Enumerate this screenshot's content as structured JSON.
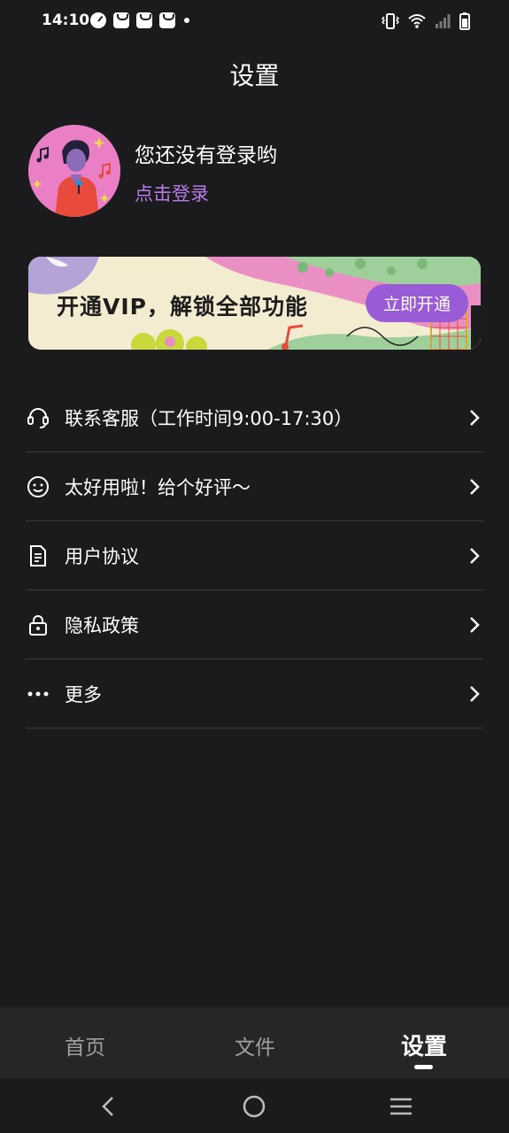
{
  "status_bar": {
    "time": "14:10",
    "left_icons": [
      "gauge-icon",
      "bag-icon",
      "bag-icon",
      "bag-icon",
      "dot-icon"
    ],
    "right_icons": [
      "vibrate-icon",
      "wifi-icon",
      "signal-icon",
      "battery-icon"
    ]
  },
  "header": {
    "title": "设置"
  },
  "profile": {
    "title": "您还没有登录哟",
    "login_link": "点击登录",
    "avatar_colors": {
      "bg": "#ea7fc6"
    }
  },
  "vip_banner": {
    "text": "开通VIP，解锁全部功能",
    "button_label": "立即开通",
    "button_color": "#9a5bd6"
  },
  "menu": {
    "items": [
      {
        "label": "联系客服（工作时间9:00-17:30）",
        "icon": "headset-icon"
      },
      {
        "label": "太好用啦！给个好评～",
        "icon": "smile-icon"
      },
      {
        "label": "用户协议",
        "icon": "document-icon"
      },
      {
        "label": "隐私政策",
        "icon": "lock-icon"
      },
      {
        "label": "更多",
        "icon": "more-icon"
      }
    ]
  },
  "tabs": [
    {
      "label": "首页",
      "active": false
    },
    {
      "label": "文件",
      "active": false
    },
    {
      "label": "设置",
      "active": true
    }
  ],
  "system_nav": [
    "back-icon",
    "home-icon",
    "recents-icon"
  ],
  "colors": {
    "background": "#1b1b1d",
    "accent": "#b77ce8",
    "divider": "#3a3a3d",
    "tab_bar": "#262628"
  }
}
